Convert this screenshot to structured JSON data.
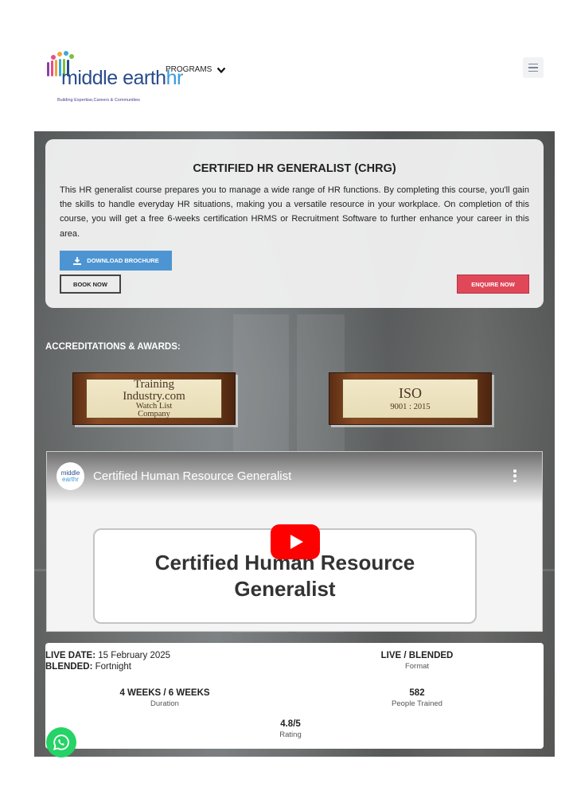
{
  "header": {
    "logo_text_main": "middle earth",
    "logo_text_accent": "hr",
    "logo_tagline": "Building Expertise,Careers & Communities",
    "nav_programs_label": "PROGRAMS"
  },
  "course": {
    "title": "CERTIFIED HR GENERALIST (CHRG)",
    "description": "This HR generalist course prepares you to manage a wide range of HR functions. By completing this course, you'll gain the skills to handle everyday HR situations, making you a versatile resource in your workplace. On completion of this course, you will get a free 6-weeks certification HRMS or Recruitment Software to further enhance your career in this area.",
    "download_label": "DOWNLOAD BROCHURE",
    "book_label": "BOOK NOW",
    "enquire_label": "ENQUIRE NOW"
  },
  "accreditations": {
    "heading": "ACCREDITATIONS & AWARDS:",
    "plaques": [
      {
        "line1": "Training",
        "line2": "Industry.com",
        "line3": "Watch List",
        "line4": "Company"
      },
      {
        "line1": "ISO",
        "line2": "9001 : 2015"
      }
    ]
  },
  "video": {
    "channel_line1": "middle",
    "channel_line2": "earthr",
    "title": "Certified Human Resource Generalist",
    "slide_line1": "Certified Human Resource",
    "slide_line2": "Generalist"
  },
  "info": {
    "live_date_label": "LIVE DATE:",
    "live_date_value": "15 February 2025",
    "blended_label": "BLENDED:",
    "blended_value": "Fortnight",
    "format_value": "LIVE / BLENDED",
    "format_label": "Format",
    "duration_value": "4 WEEKS / 6 WEEKS",
    "duration_label": "Duration",
    "people_value": "582",
    "people_label": "People Trained",
    "rating_value": "4.8/5",
    "rating_label": "Rating"
  },
  "colors": {
    "brochure_button": "#4d95d2",
    "enquire_button": "#e0485a",
    "whatsapp": "#25d366",
    "youtube_red": "#ff0000"
  },
  "icons": [
    "chevron-down-icon",
    "menu-icon",
    "download-icon",
    "more-vert-icon",
    "play-icon",
    "whatsapp-icon"
  ]
}
